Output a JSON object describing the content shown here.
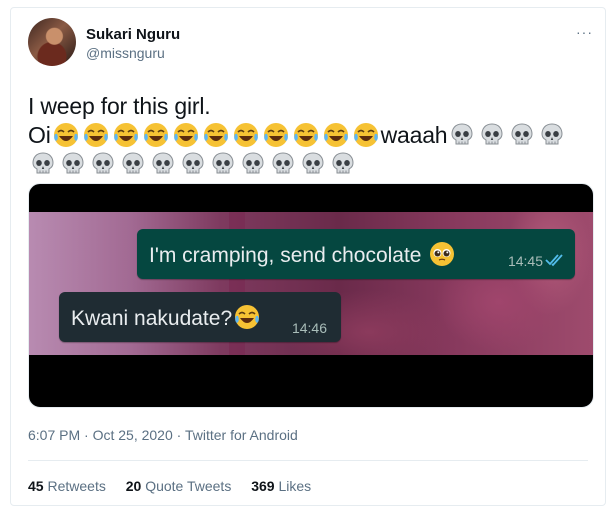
{
  "author": {
    "name": "Sukari Nguru",
    "handle": "@missnguru"
  },
  "more_icon": "···",
  "tweet": {
    "line1": "I weep for this girl.",
    "line2_prefix": "Oi",
    "laugh_emoji_count": 11,
    "line2_word": "waaah",
    "skull_emoji_count_line2": 4,
    "skull_emoji_count_line3": 11,
    "emoji_names": [
      "face-with-tears-of-joy-icon",
      "skull-icon"
    ]
  },
  "media": {
    "sent_message": "I'm cramping, send chocolate",
    "sent_emoji": "pleading-face-icon",
    "sent_time": "14:45",
    "received_message": "Kwani nakudate?",
    "received_emoji": "face-with-tears-of-joy-icon",
    "received_time": "14:46",
    "bubble_colors": {
      "sent": "#054740",
      "received": "#1f2c33",
      "ticks": "#53bdeb"
    }
  },
  "meta": {
    "time": "6:07 PM",
    "separator": "·",
    "date": "Oct 25, 2020",
    "source": "Twitter for Android"
  },
  "stats": {
    "retweets_count": "45",
    "retweets_label": "Retweets",
    "quotes_count": "20",
    "quotes_label": "Quote Tweets",
    "likes_count": "369",
    "likes_label": "Likes"
  }
}
